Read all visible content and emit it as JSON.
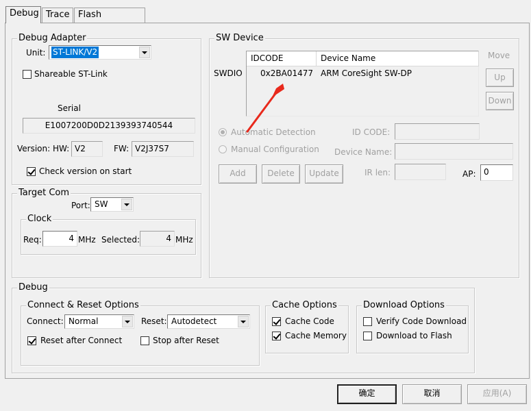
{
  "tabs": [
    "Debug",
    "Trace",
    "Flash Download"
  ],
  "debug_adapter": {
    "title": "Debug Adapter",
    "unit_label": "Unit:",
    "unit_value": "ST-LINK/V2",
    "shareable_label": "Shareable ST-Link",
    "shareable_checked": false,
    "serial_label": "Serial",
    "serial_value": "E1007200D0D2139393740544",
    "version_label": "Version: HW:",
    "hw_value": "V2",
    "fw_label": "FW:",
    "fw_value": "V2J37S7",
    "check_version_label": "Check version on start",
    "check_version_checked": true
  },
  "target_com": {
    "title": "Target Com",
    "port_label": "Port:",
    "port_value": "SW",
    "clock": {
      "title": "Clock",
      "req_label": "Req:",
      "req_value": "4",
      "req_unit": "MHz",
      "selected_label": "Selected:",
      "selected_value": "4",
      "selected_unit": "MHz"
    }
  },
  "sw_device": {
    "title": "SW Device",
    "swdio_label": "SWDIO",
    "columns": [
      "IDCODE",
      "Device Name"
    ],
    "rows": [
      {
        "idcode": "0x2BA01477",
        "device_name": "ARM CoreSight SW-DP"
      }
    ],
    "move_label": "Move",
    "up_label": "Up",
    "down_label": "Down",
    "auto_detection_label": "Automatic Detection",
    "manual_config_label": "Manual Configuration",
    "id_code_label": "ID CODE:",
    "device_name_label": "Device Name:",
    "ir_len_label": "IR len:",
    "ap_label": "AP:",
    "ap_value": "0",
    "add_label": "Add",
    "delete_label": "Delete",
    "update_label": "Update"
  },
  "debug": {
    "title": "Debug",
    "connect_reset": {
      "title": "Connect & Reset Options",
      "connect_label": "Connect:",
      "connect_value": "Normal",
      "reset_label": "Reset:",
      "reset_value": "Autodetect",
      "reset_after_connect_label": "Reset after Connect",
      "reset_after_connect_checked": true,
      "stop_after_reset_label": "Stop after Reset",
      "stop_after_reset_checked": false
    },
    "cache_options": {
      "title": "Cache Options",
      "cache_code_label": "Cache Code",
      "cache_code_checked": true,
      "cache_memory_label": "Cache Memory",
      "cache_memory_checked": true
    },
    "download_options": {
      "title": "Download Options",
      "verify_label": "Verify Code Download",
      "verify_checked": false,
      "download_flash_label": "Download to Flash",
      "download_flash_checked": false
    }
  },
  "footer": {
    "ok_label": "确定",
    "cancel_label": "取消",
    "apply_label": "应用(A)"
  },
  "colors": {
    "arrow": "#e8291c",
    "selection": "#0078d7"
  }
}
